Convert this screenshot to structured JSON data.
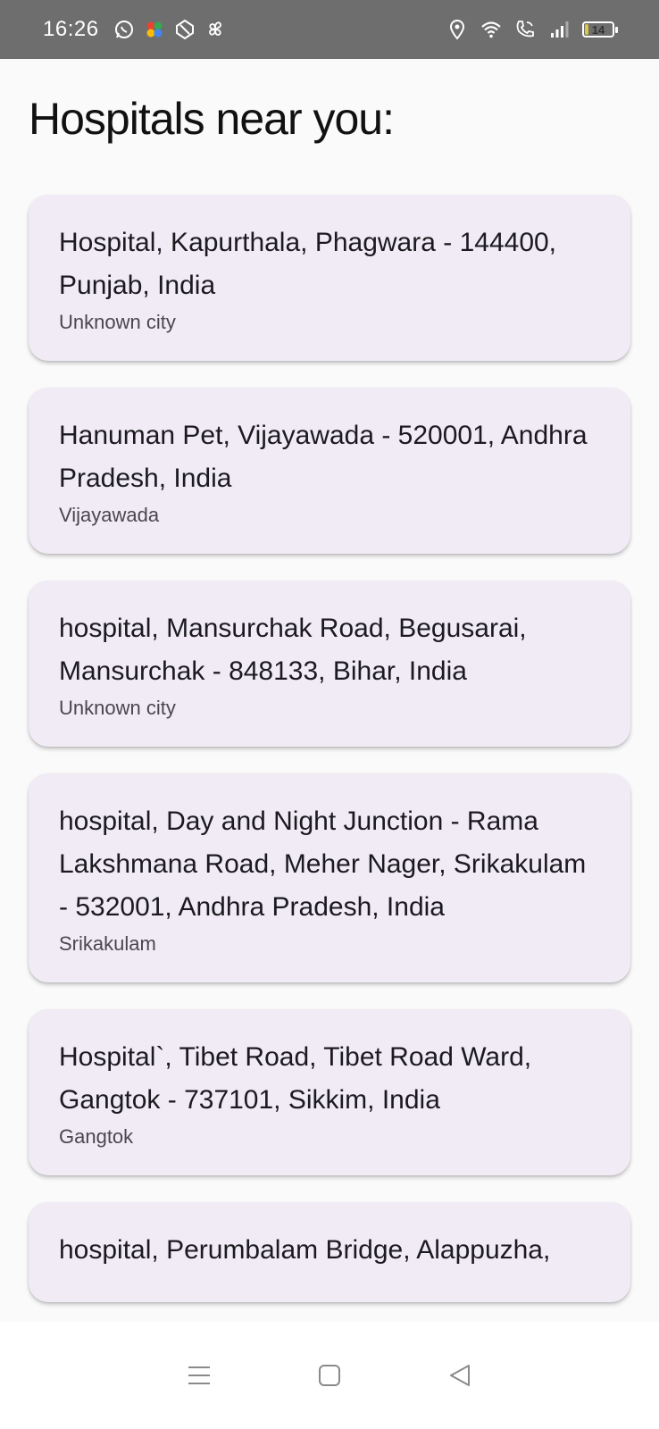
{
  "status_bar": {
    "time": "16:26",
    "left_icons": [
      "whatsapp-icon",
      "pinwheel-app-icon",
      "vpn-icon",
      "fan-icon"
    ],
    "right_icons": [
      "location-icon",
      "wifi-icon",
      "wifi-calling-icon",
      "signal-icon"
    ],
    "battery_level": "14",
    "battery_fill_color": "#d6c84a"
  },
  "page": {
    "title": "Hospitals near you:"
  },
  "hospitals": [
    {
      "address": "Hospital, Kapurthala, Phagwara - 144400, Punjab, India",
      "city": "Unknown city"
    },
    {
      "address": "Hanuman Pet, Vijayawada - 520001, Andhra Pradesh, India",
      "city": "Vijayawada"
    },
    {
      "address": "hospital, Mansurchak Road, Begusarai, Mansurchak - 848133, Bihar, India",
      "city": "Unknown city"
    },
    {
      "address": "hospital, Day and Night Junction - Rama Lakshmana Road, Meher Nager, Srikakulam - 532001, Andhra Pradesh, India",
      "city": "Srikakulam"
    },
    {
      "address": "Hospital`, Tibet Road, Tibet Road Ward, Gangtok - 737101, Sikkim, India",
      "city": "Gangtok"
    },
    {
      "address": "hospital, Perumbalam Bridge, Alappuzha,",
      "city": ""
    }
  ],
  "nav_bar": {
    "buttons": [
      "menu-icon",
      "home-icon",
      "back-icon"
    ]
  },
  "colors": {
    "card_background": "#f1ebf5",
    "status_bar_background": "#6e6e6e",
    "page_background": "#fafafa"
  }
}
